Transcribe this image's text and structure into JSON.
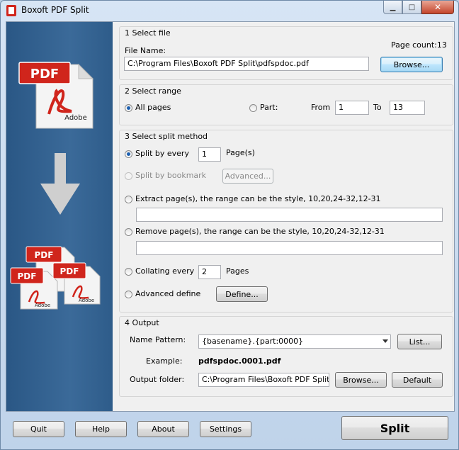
{
  "window": {
    "title": "Boxoft PDF Split",
    "min_glyph": "▁",
    "max_glyph": "□",
    "close_glyph": "✕"
  },
  "sidebar": {
    "top_badge": "PDF",
    "top_caption": "Adobe",
    "out_badges": [
      "PDF",
      "PDF",
      "PDF"
    ],
    "out_captions": [
      "Ad",
      "Adobe",
      "Adobe"
    ]
  },
  "select_file": {
    "title": "1 Select file",
    "page_count_label": "Page count:",
    "page_count": "13",
    "file_name_label": "File Name:",
    "file_path": "C:\\Program Files\\Boxoft PDF Split\\pdfspdoc.pdf",
    "browse_label": "Browse..."
  },
  "select_range": {
    "title": "2 Select range",
    "all_pages_label": "All pages",
    "part_label": "Part:",
    "from_label": "From",
    "from_value": "1",
    "to_label": "To",
    "to_value": "13"
  },
  "split_method": {
    "title": "3 Select split method",
    "split_every_label": "Split by every",
    "split_every_value": "1",
    "pages_unit": "Page(s)",
    "bookmark_label": "Split by bookmark",
    "advanced_label": "Advanced...",
    "extract_label": "Extract page(s), the range can be the style, 10,20,24-32,12-31",
    "extract_value": "",
    "remove_label": "Remove page(s), the range can be the style, 10,20,24-32,12-31",
    "remove_value": "",
    "collating_label": "Collating every",
    "collating_value": "2",
    "collating_unit": "Pages",
    "advanced_define_label": "Advanced define",
    "define_label": "Define..."
  },
  "output": {
    "title": "4 Output",
    "name_pattern_label": "Name Pattern:",
    "name_pattern_value": "{basename}.{part:0000}",
    "list_label": "List...",
    "example_label": "Example:",
    "example_value": "pdfspdoc.0001.pdf",
    "output_folder_label": "Output folder:",
    "output_folder_value": "C:\\Program Files\\Boxoft PDF Split",
    "browse_label": "Browse...",
    "default_label": "Default"
  },
  "footer": {
    "quit": "Quit",
    "help": "Help",
    "about": "About",
    "settings": "Settings",
    "split": "Split"
  },
  "colors": {
    "accent": "#3c7fb1",
    "pdf_red": "#d0251c",
    "sidebar": "#2f5e8e"
  }
}
